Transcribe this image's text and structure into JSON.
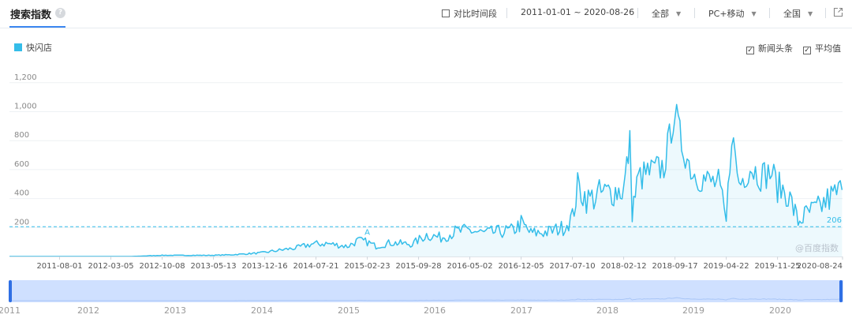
{
  "header": {
    "title": "搜索指数",
    "help_icon": "question-circle-icon",
    "compare_label": "对比时间段",
    "date_range": "2011-01-01 ~ 2020-08-26",
    "source_filter": "全部",
    "device_filter": "PC+移动",
    "region_filter": "全国",
    "export_icon": "external-link-icon"
  },
  "legend": {
    "series_name": "快闪店",
    "color": "#34bde9"
  },
  "toggles": {
    "news_label": "新闻头条",
    "news_checked": true,
    "avg_label": "平均值",
    "avg_checked": true
  },
  "watermark": "@百度指数",
  "brush": {
    "years": [
      "2011",
      "2012",
      "2013",
      "2014",
      "2015",
      "2016",
      "2017",
      "2018",
      "2019",
      "2020"
    ]
  },
  "chart_data": {
    "type": "area",
    "series": [
      {
        "name": "快闪店",
        "color": "#34bde9"
      }
    ],
    "y_ticks": [
      "200",
      "400",
      "600",
      "800",
      "1,000",
      "1,200"
    ],
    "ylim": [
      0,
      1300
    ],
    "x_ticks": [
      "2011-08-01",
      "2012-03-05",
      "2012-10-08",
      "2013-05-13",
      "2013-12-16",
      "2014-07-21",
      "2015-02-23",
      "2015-09-28",
      "2016-05-02",
      "2016-12-05",
      "2017-07-10",
      "2018-02-12",
      "2018-09-17",
      "2019-04-22",
      "2019-11-25",
      "2020-08-24"
    ],
    "average": 206,
    "average_label": "206",
    "annotation": "A",
    "points": [
      [
        "2011-01-01",
        0
      ],
      [
        "2012-06-01",
        0
      ],
      [
        "2012-10-01",
        8
      ],
      [
        "2013-05-01",
        8
      ],
      [
        "2013-08-01",
        12
      ],
      [
        "2013-12-01",
        25
      ],
      [
        "2014-02-01",
        40
      ],
      [
        "2014-05-01",
        60
      ],
      [
        "2014-07-01",
        85
      ],
      [
        "2014-09-01",
        90
      ],
      [
        "2014-12-01",
        70
      ],
      [
        "2015-01-15",
        110
      ],
      [
        "2015-02-23",
        100
      ],
      [
        "2015-04-01",
        70
      ],
      [
        "2015-06-01",
        95
      ],
      [
        "2015-09-01",
        85
      ],
      [
        "2015-11-01",
        150
      ],
      [
        "2016-01-01",
        130
      ],
      [
        "2016-03-01",
        170
      ],
      [
        "2016-05-01",
        180
      ],
      [
        "2016-07-01",
        160
      ],
      [
        "2016-09-01",
        170
      ],
      [
        "2016-11-01",
        180
      ],
      [
        "2016-12-05",
        230
      ],
      [
        "2017-01-15",
        160
      ],
      [
        "2017-04-01",
        170
      ],
      [
        "2017-06-01",
        200
      ],
      [
        "2017-07-10",
        270
      ],
      [
        "2017-08-01",
        480
      ],
      [
        "2017-09-15",
        390
      ],
      [
        "2017-11-01",
        430
      ],
      [
        "2018-01-01",
        450
      ],
      [
        "2018-02-12",
        460
      ],
      [
        "2018-03-10",
        780
      ],
      [
        "2018-03-20",
        320
      ],
      [
        "2018-04-15",
        540
      ],
      [
        "2018-06-01",
        580
      ],
      [
        "2018-08-01",
        620
      ],
      [
        "2018-09-17",
        1010
      ],
      [
        "2018-10-15",
        780
      ],
      [
        "2018-12-01",
        580
      ],
      [
        "2019-02-01",
        520
      ],
      [
        "2019-03-20",
        500
      ],
      [
        "2019-04-22",
        230
      ],
      [
        "2019-05-15",
        860
      ],
      [
        "2019-06-15",
        500
      ],
      [
        "2019-08-01",
        620
      ],
      [
        "2019-09-15",
        560
      ],
      [
        "2019-11-01",
        580
      ],
      [
        "2019-11-25",
        480
      ],
      [
        "2020-01-01",
        450
      ],
      [
        "2020-02-01",
        330
      ],
      [
        "2020-02-20",
        240
      ],
      [
        "2020-04-01",
        300
      ],
      [
        "2020-05-15",
        330
      ],
      [
        "2020-07-01",
        400
      ],
      [
        "2020-08-24",
        460
      ]
    ]
  }
}
